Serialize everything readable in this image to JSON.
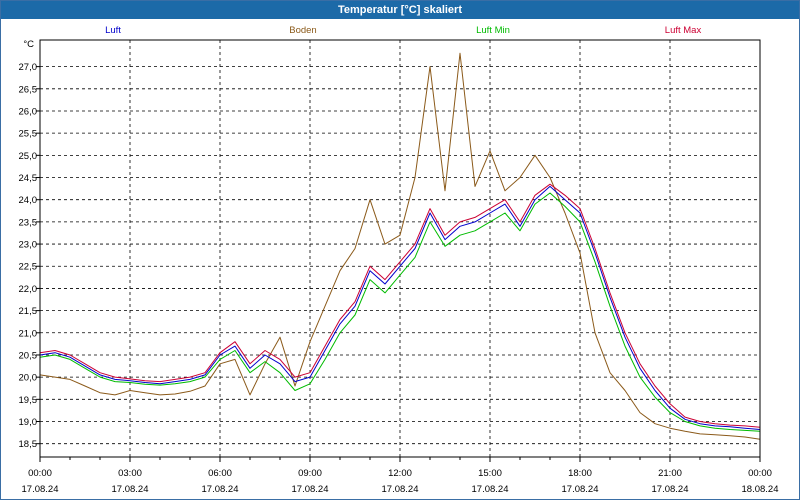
{
  "window": {
    "title": "Temperatur [°C] skaliert"
  },
  "chart_data": {
    "type": "line",
    "title": "Temperatur [°C] skaliert",
    "ylabel": "°C",
    "xlabel": "",
    "ylim": [
      18.2,
      27.6
    ],
    "xlim": [
      0,
      24
    ],
    "grid": true,
    "legend_position": "top",
    "y_ticks": [
      "18,5",
      "19,0",
      "19,5",
      "20,0",
      "20,5",
      "21,0",
      "21,5",
      "22,0",
      "22,5",
      "23,0",
      "23,5",
      "24,0",
      "24,5",
      "25,0",
      "25,5",
      "26,0",
      "26,5",
      "27,0"
    ],
    "x_ticks": [
      {
        "time": "00:00",
        "date": "17.08.24"
      },
      {
        "time": "03:00",
        "date": "17.08.24"
      },
      {
        "time": "06:00",
        "date": "17.08.24"
      },
      {
        "time": "09:00",
        "date": "17.08.24"
      },
      {
        "time": "12:00",
        "date": "17.08.24"
      },
      {
        "time": "15:00",
        "date": "17.08.24"
      },
      {
        "time": "18:00",
        "date": "17.08.24"
      },
      {
        "time": "21:00",
        "date": "17.08.24"
      },
      {
        "time": "00:00",
        "date": "18.08.24"
      }
    ],
    "series": [
      {
        "name": "Luft",
        "color": "#0000cc",
        "x": [
          0,
          0.5,
          1,
          1.5,
          2,
          2.5,
          3,
          3.5,
          4,
          4.5,
          5,
          5.5,
          6,
          6.5,
          7,
          7.5,
          8,
          8.5,
          9,
          9.5,
          10,
          10.5,
          11,
          11.5,
          12,
          12.5,
          13,
          13.5,
          14,
          14.5,
          15,
          15.5,
          16,
          16.5,
          17,
          17.5,
          18,
          18.5,
          19,
          19.5,
          20,
          20.5,
          21,
          21.5,
          22,
          22.5,
          23,
          23.5,
          24
        ],
        "values": [
          20.5,
          20.55,
          20.45,
          20.25,
          20.05,
          19.95,
          19.92,
          19.88,
          19.85,
          19.9,
          19.95,
          20.05,
          20.5,
          20.7,
          20.2,
          20.5,
          20.3,
          19.9,
          20.0,
          20.6,
          21.2,
          21.6,
          22.4,
          22.1,
          22.5,
          22.9,
          23.7,
          23.1,
          23.4,
          23.5,
          23.7,
          23.9,
          23.4,
          24.0,
          24.3,
          24.0,
          23.7,
          22.8,
          21.8,
          20.9,
          20.2,
          19.7,
          19.3,
          19.05,
          18.95,
          18.9,
          18.88,
          18.85,
          18.82
        ]
      },
      {
        "name": "Boden",
        "color": "#8b5a1a",
        "x": [
          0,
          0.5,
          1,
          1.5,
          2,
          2.5,
          3,
          3.5,
          4,
          4.5,
          5,
          5.5,
          6,
          6.5,
          7,
          7.5,
          8,
          8.5,
          9,
          9.5,
          10,
          10.5,
          11,
          11.5,
          12,
          12.5,
          13,
          13.5,
          14,
          14.5,
          15,
          15.5,
          16,
          16.5,
          17,
          17.5,
          18,
          18.5,
          19,
          19.5,
          20,
          20.5,
          21,
          21.5,
          22,
          22.5,
          23,
          23.5,
          24
        ],
        "values": [
          20.05,
          20.0,
          19.95,
          19.8,
          19.65,
          19.6,
          19.7,
          19.65,
          19.6,
          19.62,
          19.68,
          19.8,
          20.3,
          20.4,
          19.6,
          20.3,
          20.9,
          19.8,
          20.8,
          21.6,
          22.4,
          22.9,
          24.0,
          23.0,
          23.2,
          24.5,
          27.0,
          24.2,
          27.3,
          24.3,
          25.1,
          24.2,
          24.5,
          25.0,
          24.5,
          23.7,
          22.8,
          21.0,
          20.1,
          19.7,
          19.2,
          18.95,
          18.85,
          18.78,
          18.72,
          18.7,
          18.68,
          18.65,
          18.6
        ]
      },
      {
        "name": "Luft Min",
        "color": "#00bb00",
        "x": [
          0,
          0.5,
          1,
          1.5,
          2,
          2.5,
          3,
          3.5,
          4,
          4.5,
          5,
          5.5,
          6,
          6.5,
          7,
          7.5,
          8,
          8.5,
          9,
          9.5,
          10,
          10.5,
          11,
          11.5,
          12,
          12.5,
          13,
          13.5,
          14,
          14.5,
          15,
          15.5,
          16,
          16.5,
          17,
          17.5,
          18,
          18.5,
          19,
          19.5,
          20,
          20.5,
          21,
          21.5,
          22,
          22.5,
          23,
          23.5,
          24
        ],
        "values": [
          20.45,
          20.5,
          20.4,
          20.2,
          20.0,
          19.9,
          19.88,
          19.84,
          19.82,
          19.85,
          19.9,
          20.0,
          20.4,
          20.6,
          20.1,
          20.35,
          20.1,
          19.7,
          19.85,
          20.4,
          21.0,
          21.4,
          22.2,
          21.9,
          22.3,
          22.7,
          23.5,
          22.95,
          23.2,
          23.3,
          23.5,
          23.7,
          23.3,
          23.9,
          24.15,
          23.85,
          23.5,
          22.6,
          21.6,
          20.7,
          20.0,
          19.55,
          19.2,
          19.0,
          18.9,
          18.85,
          18.82,
          18.8,
          18.78
        ]
      },
      {
        "name": "Luft Max",
        "color": "#cc0033",
        "x": [
          0,
          0.5,
          1,
          1.5,
          2,
          2.5,
          3,
          3.5,
          4,
          4.5,
          5,
          5.5,
          6,
          6.5,
          7,
          7.5,
          8,
          8.5,
          9,
          9.5,
          10,
          10.5,
          11,
          11.5,
          12,
          12.5,
          13,
          13.5,
          14,
          14.5,
          15,
          15.5,
          16,
          16.5,
          17,
          17.5,
          18,
          18.5,
          19,
          19.5,
          20,
          20.5,
          21,
          21.5,
          22,
          22.5,
          23,
          23.5,
          24
        ],
        "values": [
          20.55,
          20.6,
          20.5,
          20.3,
          20.1,
          20.0,
          19.96,
          19.92,
          19.9,
          19.95,
          20.0,
          20.1,
          20.55,
          20.8,
          20.3,
          20.6,
          20.4,
          20.0,
          20.1,
          20.7,
          21.3,
          21.7,
          22.5,
          22.2,
          22.6,
          23.0,
          23.8,
          23.2,
          23.5,
          23.6,
          23.8,
          24.0,
          23.5,
          24.1,
          24.35,
          24.1,
          23.8,
          22.9,
          21.9,
          21.0,
          20.3,
          19.8,
          19.4,
          19.1,
          19.0,
          18.95,
          18.92,
          18.9,
          18.87
        ]
      }
    ]
  }
}
